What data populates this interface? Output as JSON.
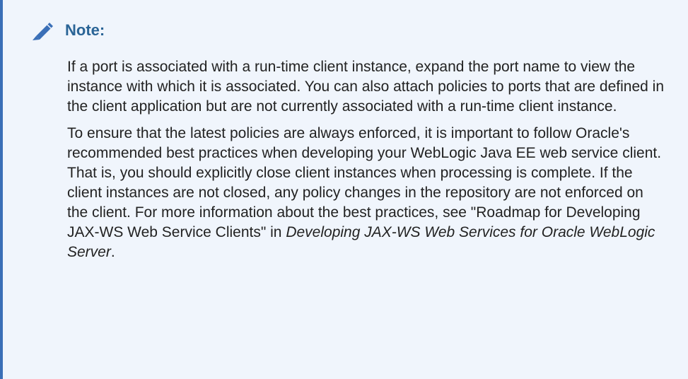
{
  "note": {
    "title": "Note:",
    "icon": "pencil-icon",
    "accent_color": "#3a6fb7",
    "background_color": "#f0f5fc",
    "title_color": "#2a6496",
    "paragraph1": "If a port is associated with a run-time client instance, expand the port name to view the instance with which it is associated. You can also attach policies to ports that are defined in the client application but are not currently associated with a run-time client instance.",
    "paragraph2_main": "To ensure that the latest policies are always enforced, it is important to follow Oracle's recommended best practices when developing your WebLogic Java EE web service client. That is, you should explicitly close client instances when processing is complete. If the client instances are not closed, any policy changes in the repository are not enforced on the client. For more information about the best practices, see \"Roadmap for Developing JAX-WS Web Service Clients\" in ",
    "paragraph2_book": "Developing JAX-WS Web Services for Oracle WebLogic Server",
    "paragraph2_end": "."
  }
}
